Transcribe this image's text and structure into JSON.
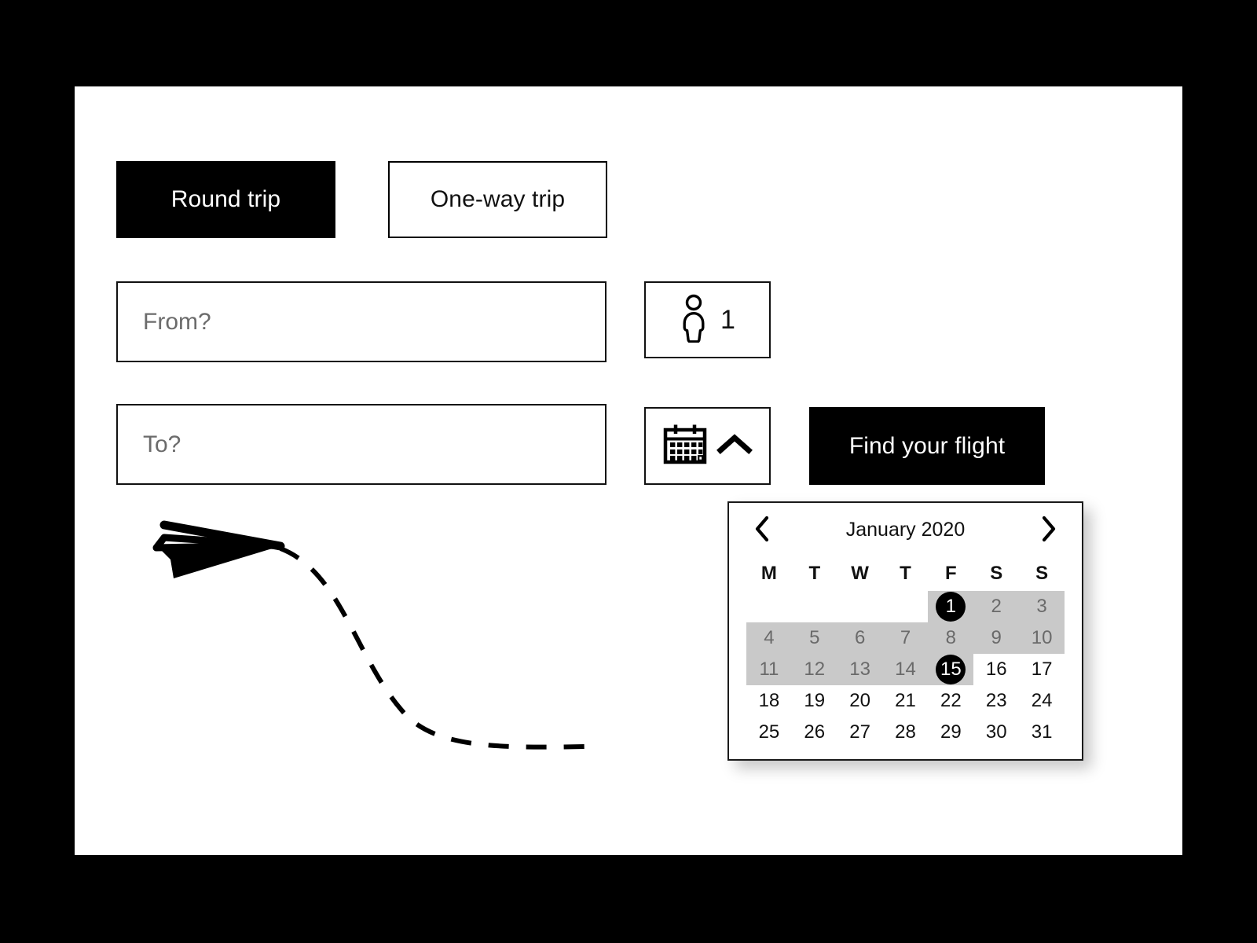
{
  "theme": {
    "page_background": "#000000",
    "canvas_background": "#ffffff",
    "accent": "#000000",
    "placeholder_text": "#6b6b6b",
    "range_highlight": "#c9c9c9",
    "range_text": "#6a6a6a"
  },
  "trip_type": {
    "options": [
      {
        "label": "Round trip",
        "selected": true
      },
      {
        "label": "One-way trip",
        "selected": false
      }
    ]
  },
  "search_form": {
    "origin": {
      "placeholder": "From?",
      "value": ""
    },
    "destination": {
      "placeholder": "To?",
      "value": ""
    },
    "passengers": {
      "icon": "person-icon",
      "count": "1"
    },
    "dates": {
      "icon": "calendar-icon",
      "toggle_icon": "chevron-up-icon"
    },
    "submit_label": "Find your flight"
  },
  "illustration": {
    "name": "paper-plane-with-dashed-trail"
  },
  "calendar": {
    "title": "January 2020",
    "prev_icon": "chevron-left-icon",
    "next_icon": "chevron-right-icon",
    "day_headers": [
      "M",
      "T",
      "W",
      "T",
      "F",
      "S",
      "S"
    ],
    "leading_blanks": 4,
    "weeks": [
      [
        {
          "day": "",
          "state": "empty"
        },
        {
          "day": "",
          "state": "empty"
        },
        {
          "day": "",
          "state": "empty"
        },
        {
          "day": "",
          "state": "empty"
        },
        {
          "day": "1",
          "state": "selected"
        },
        {
          "day": "2",
          "state": "range"
        },
        {
          "day": "3",
          "state": "range"
        }
      ],
      [
        {
          "day": "4",
          "state": "range"
        },
        {
          "day": "5",
          "state": "range"
        },
        {
          "day": "6",
          "state": "range"
        },
        {
          "day": "7",
          "state": "range"
        },
        {
          "day": "8",
          "state": "range"
        },
        {
          "day": "9",
          "state": "range"
        },
        {
          "day": "10",
          "state": "range"
        }
      ],
      [
        {
          "day": "11",
          "state": "range"
        },
        {
          "day": "12",
          "state": "range"
        },
        {
          "day": "13",
          "state": "range"
        },
        {
          "day": "14",
          "state": "range"
        },
        {
          "day": "15",
          "state": "selected"
        },
        {
          "day": "16",
          "state": "normal"
        },
        {
          "day": "17",
          "state": "normal"
        }
      ],
      [
        {
          "day": "18",
          "state": "normal"
        },
        {
          "day": "19",
          "state": "normal"
        },
        {
          "day": "20",
          "state": "normal"
        },
        {
          "day": "21",
          "state": "normal"
        },
        {
          "day": "22",
          "state": "normal"
        },
        {
          "day": "23",
          "state": "normal"
        },
        {
          "day": "24",
          "state": "normal"
        }
      ],
      [
        {
          "day": "25",
          "state": "normal"
        },
        {
          "day": "26",
          "state": "normal"
        },
        {
          "day": "27",
          "state": "normal"
        },
        {
          "day": "28",
          "state": "normal"
        },
        {
          "day": "29",
          "state": "normal"
        },
        {
          "day": "30",
          "state": "normal"
        },
        {
          "day": "31",
          "state": "normal"
        }
      ]
    ]
  }
}
